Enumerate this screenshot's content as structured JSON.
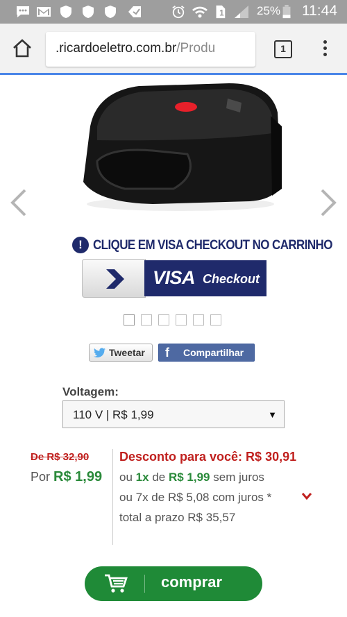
{
  "status_bar": {
    "battery": "25%",
    "time": "11:44"
  },
  "browser": {
    "url_domain": ".ricardoeletro.com.br",
    "url_path": "/Produ",
    "tab_count": "1"
  },
  "product": {
    "visa_notice": "CLIQUE EM VISA CHECKOUT NO CARRINHO",
    "visa_checkout": {
      "visa": "VISA",
      "checkout": "Checkout"
    },
    "carousel": {
      "pages": 6,
      "active_index": 0
    }
  },
  "social": {
    "tweet_label": "Tweetar",
    "share_label": "Compartilhar"
  },
  "options": {
    "voltage_label": "Voltagem:",
    "voltage_selected": "110 V | R$ 1,99"
  },
  "pricing": {
    "old_price": "De R$ 32,90",
    "por_prefix": "Por",
    "por_value": "R$ 1,99",
    "discount": "Desconto para você: R$ 30,91",
    "line1_prefix": "ou",
    "line1_times": "1x",
    "line1_de": "de",
    "line1_value": "R$ 1,99",
    "line1_suffix": "sem juros",
    "line2": "ou 7x de R$ 5,08 com juros *",
    "line3": "total a prazo R$ 35,57"
  },
  "buy": {
    "label": "comprar"
  },
  "colors": {
    "status_bar": "#9e9e9e",
    "visa_navy": "#1f2a6b",
    "price_green": "#2a8a3a",
    "discount_red": "#c0201e",
    "buy_green": "#1f8a37"
  }
}
